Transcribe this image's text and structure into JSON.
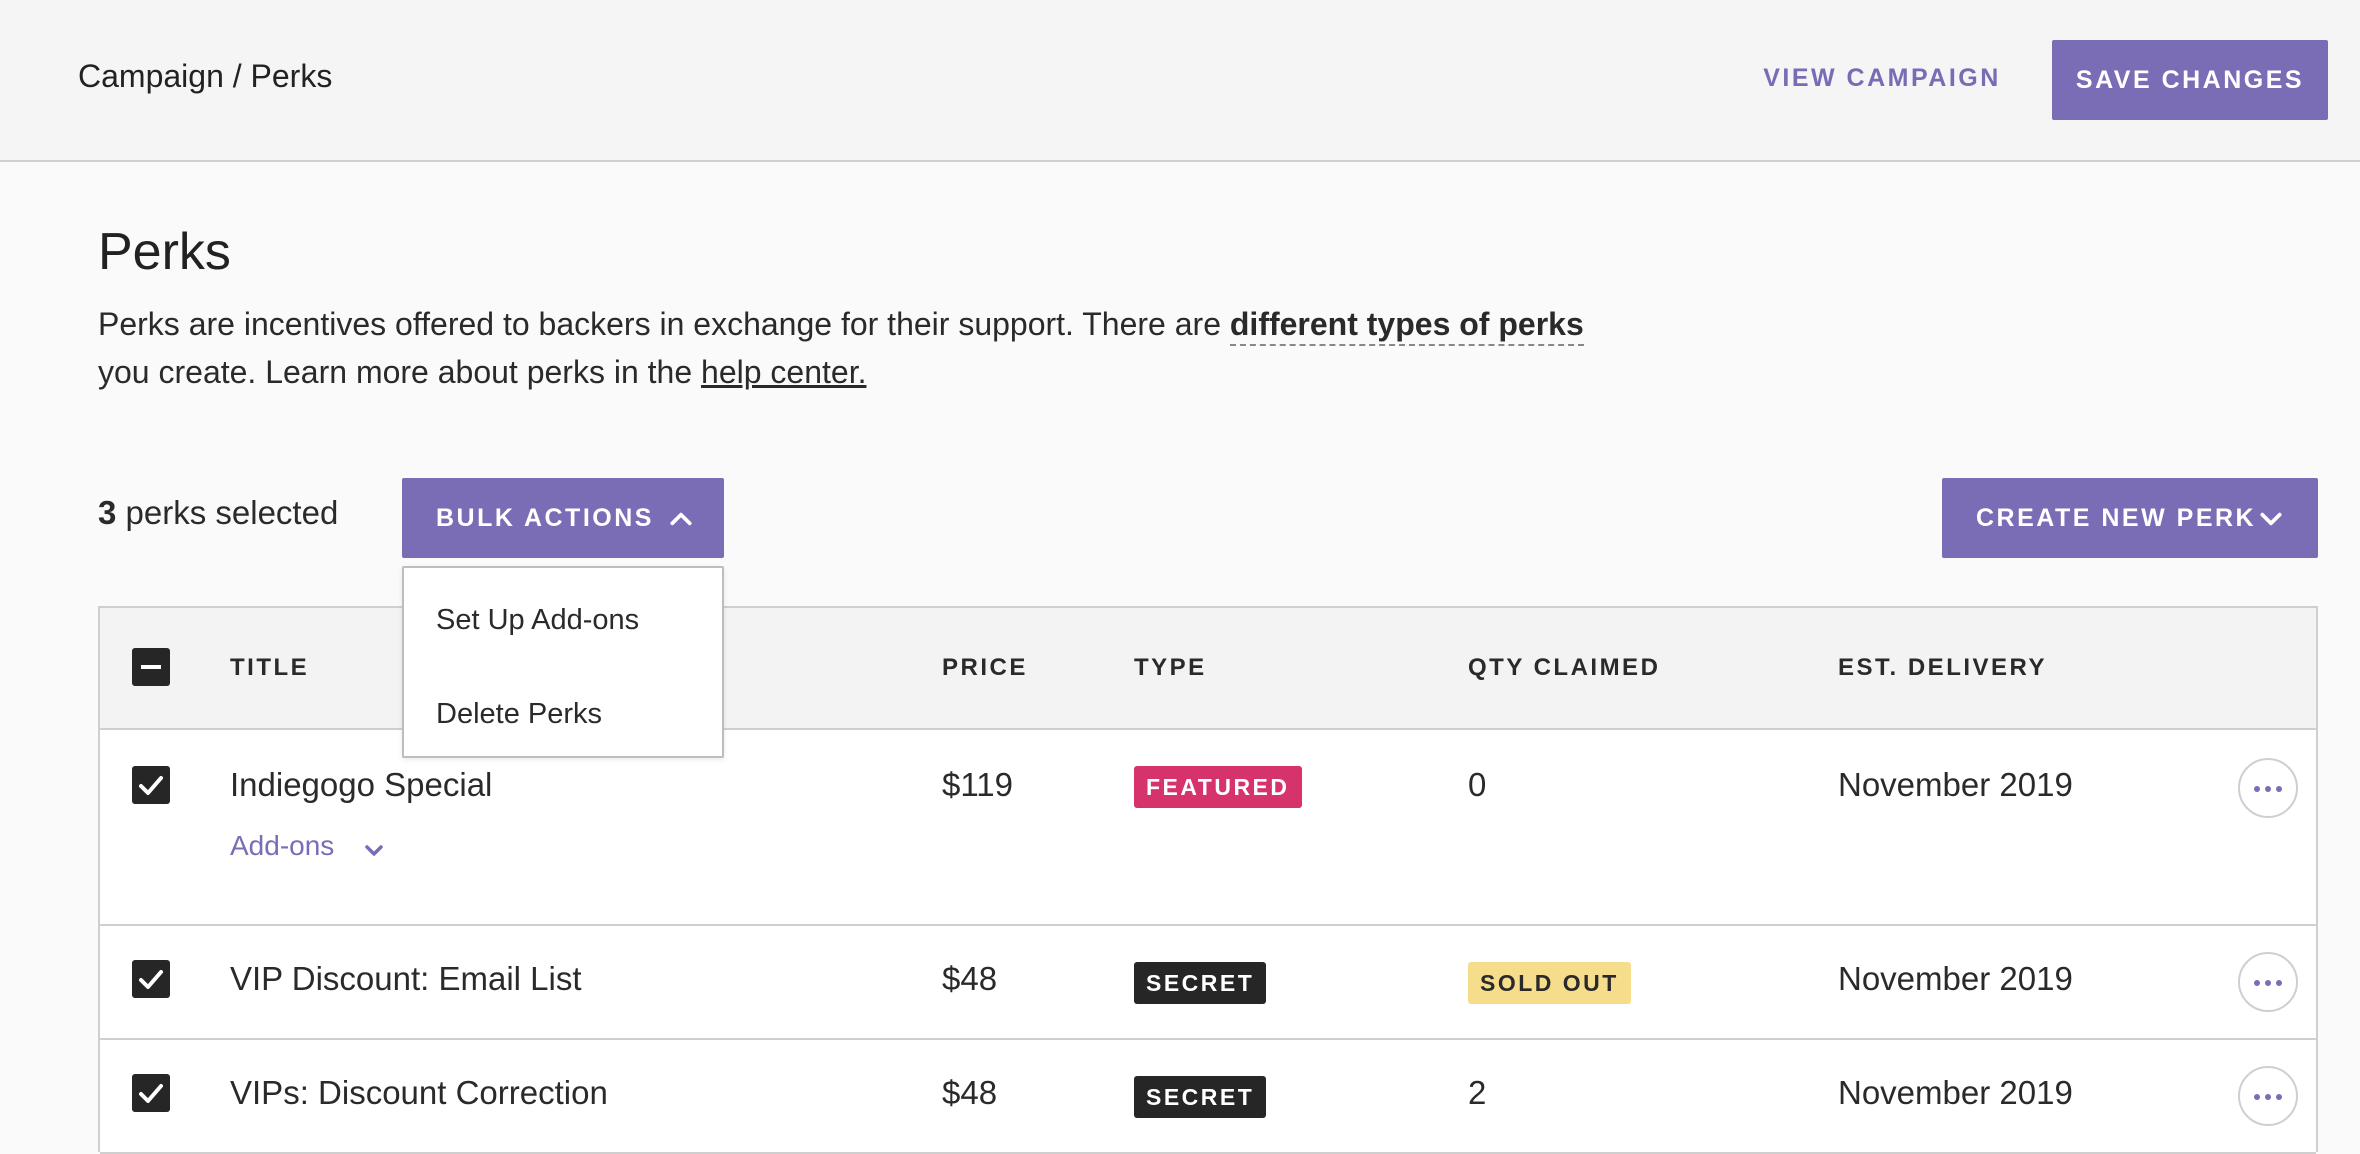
{
  "header": {
    "breadcrumb": "Campaign / Perks",
    "view_campaign_label": "VIEW CAMPAIGN",
    "save_changes_label": "SAVE CHANGES"
  },
  "page": {
    "title": "Perks",
    "intro_part1": "Perks are incentives offered to backers in exchange for their support. There are ",
    "intro_bold_link": "different types of perks",
    "intro_part2": "you create. Learn more about perks in the ",
    "intro_link": "help center."
  },
  "toolbar": {
    "selected_count": "3",
    "selected_suffix": " perks selected",
    "bulk_actions_label": "BULK ACTIONS",
    "create_new_perk_label": "CREATE NEW PERK"
  },
  "bulk_menu": {
    "items": [
      "Set Up Add-ons",
      "Delete Perks"
    ]
  },
  "table": {
    "columns": {
      "title": "TITLE",
      "price": "PRICE",
      "type": "TYPE",
      "qty_claimed": "QTY CLAIMED",
      "est_delivery": "EST. DELIVERY"
    },
    "rows": [
      {
        "title": "Indiegogo Special",
        "price": "$119",
        "type": "FEATURED",
        "qty": "0",
        "qty_badge": "",
        "delivery": "November 2019",
        "addons_label": "Add-ons"
      },
      {
        "title": "VIP Discount: Email List",
        "price": "$48",
        "type": "SECRET",
        "qty": "",
        "qty_badge": "SOLD OUT",
        "delivery": "November 2019"
      },
      {
        "title": "VIPs: Discount Correction",
        "price": "$48",
        "type": "SECRET",
        "qty": "2",
        "qty_badge": "",
        "delivery": "November 2019"
      }
    ]
  },
  "colors": {
    "accent": "#7b6cb6",
    "featured": "#d6336c",
    "secret": "#262626",
    "sold_out": "#f6dd8c"
  },
  "icons": {
    "bulk_chevron": "chevron-up-icon",
    "create_chevron": "chevron-down-icon",
    "addons_chevron": "chevron-down-icon",
    "row_menu": "more-horizontal-icon",
    "header_checkbox": "minus-checkbox-icon",
    "row_checkbox": "check-icon"
  }
}
